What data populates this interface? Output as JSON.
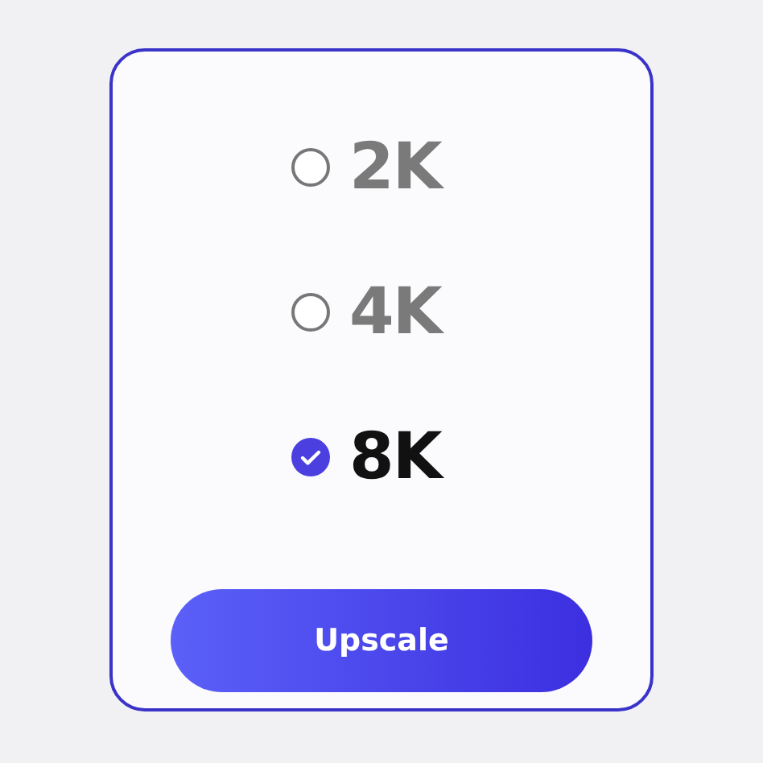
{
  "options": [
    {
      "label": "2K",
      "selected": false
    },
    {
      "label": "4K",
      "selected": false
    },
    {
      "label": "8K",
      "selected": true
    }
  ],
  "button": {
    "label": "Upscale"
  }
}
